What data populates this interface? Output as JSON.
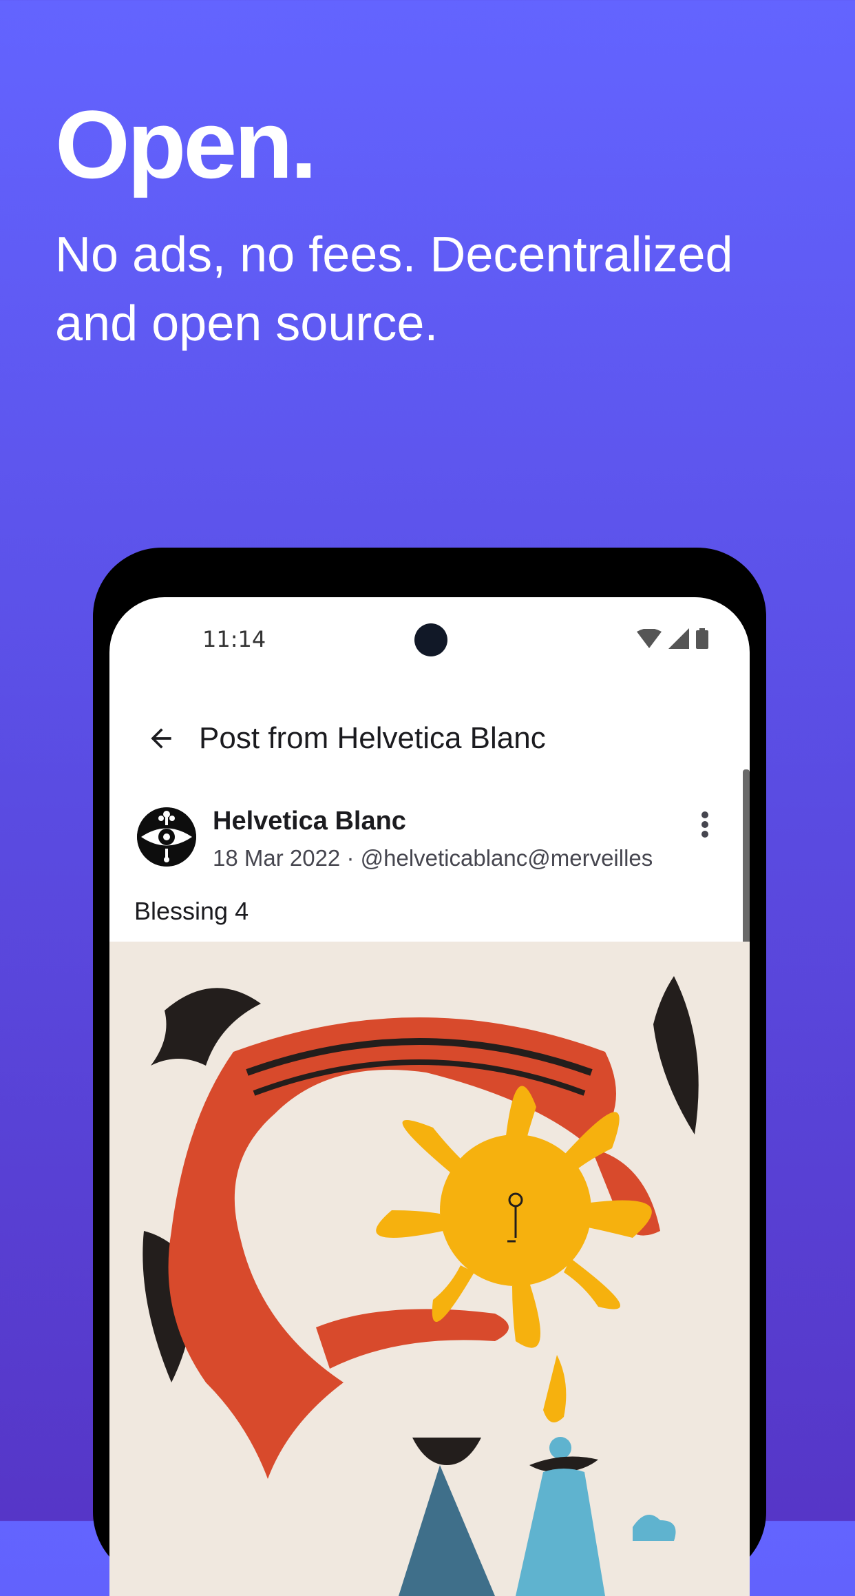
{
  "promo": {
    "headline": "Open.",
    "subline": "No ads, no fees. Decentralized and open source."
  },
  "status_bar": {
    "time": "11:14",
    "icons": [
      "wifi-icon",
      "signal-icon",
      "battery-icon"
    ]
  },
  "app_bar": {
    "back_icon": "arrow-left-icon",
    "title": "Post from Helvetica Blanc"
  },
  "post": {
    "author_name": "Helvetica Blanc",
    "meta": "18 Mar 2022 · @helveticablanc@merveilles…",
    "text": "Blessing 4",
    "menu_icon": "more-vertical-icon",
    "media_description_icon": "illustration-image"
  },
  "colors": {
    "background_top": "#6364FF",
    "background_bottom": "#5636C7",
    "media_background": "#F0E8DF",
    "sun": "#F6B10E",
    "ribbon_red": "#D84A2C",
    "dark": "#231E1C",
    "figure_blue": "#5FB3CF"
  }
}
